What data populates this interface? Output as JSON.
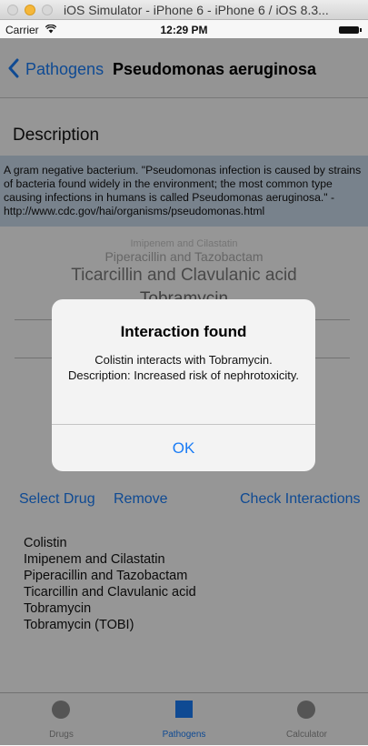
{
  "window": {
    "title": "iOS Simulator - iPhone 6 - iPhone 6 / iOS 8.3..."
  },
  "status_bar": {
    "carrier": "Carrier",
    "time": "12:29 PM"
  },
  "nav": {
    "back_label": "Pathogens",
    "title": "Pseudomonas aeruginosa"
  },
  "section": {
    "title": "Description"
  },
  "description_text": "A gram negative bacterium. \"Pseudomonas infection is caused by strains of bacteria found widely in the environment; the most common type causing infections in humans is called Pseudomonas aeruginosa.\" - http://www.cdc.gov/hai/organisms/pseudomonas.html",
  "picker": {
    "items": [
      "Imipenem and Cilastatin",
      "Piperacillin and Tazobactam",
      "Ticarcillin and Clavulanic acid",
      "Tobramycin"
    ]
  },
  "actions": {
    "select": "Select Drug",
    "remove": "Remove",
    "check": "Check Interactions"
  },
  "drug_list": [
    "Colistin",
    "Imipenem and Cilastatin",
    "Piperacillin and Tazobactam",
    "Ticarcillin and Clavulanic acid",
    "Tobramycin",
    "Tobramycin (TOBI)"
  ],
  "alert": {
    "title": "Interaction found",
    "message": "Colistin interacts with Tobramycin. Description: Increased risk of nephrotoxicity.",
    "ok": "OK"
  },
  "tabs": [
    {
      "label": "Drugs",
      "icon": "circle-icon",
      "selected": false
    },
    {
      "label": "Pathogens",
      "icon": "square-icon",
      "selected": true
    },
    {
      "label": "Calculator",
      "icon": "circle-icon",
      "selected": false
    }
  ],
  "colors": {
    "accent": "#1a7cf5",
    "description_bg": "#c9d9ea",
    "tab_inactive": "#8e8e8e"
  }
}
